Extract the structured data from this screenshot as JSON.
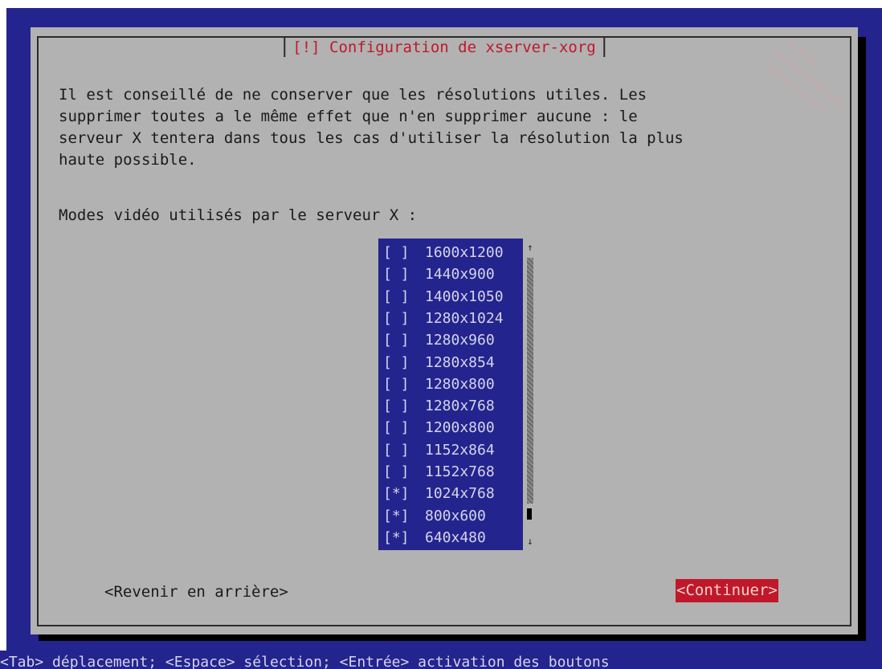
{
  "dialog": {
    "title": "[!] Configuration de xserver-xorg",
    "description": "Il est conseillé de ne conserver que les résolutions utiles. Les\nsupprimer toutes a le même effet que n'en supprimer aucune : le\nserveur X tentera dans tous les cas d'utiliser la résolution la plus\nhaute possible.",
    "modes_label": "Modes vidéo utilisés par le serveur X :"
  },
  "modes": [
    {
      "checked": false,
      "box": "[ ]",
      "label": "1600x1200"
    },
    {
      "checked": false,
      "box": "[ ]",
      "label": "1440x900"
    },
    {
      "checked": false,
      "box": "[ ]",
      "label": "1400x1050"
    },
    {
      "checked": false,
      "box": "[ ]",
      "label": "1280x1024"
    },
    {
      "checked": false,
      "box": "[ ]",
      "label": "1280x960"
    },
    {
      "checked": false,
      "box": "[ ]",
      "label": "1280x854"
    },
    {
      "checked": false,
      "box": "[ ]",
      "label": "1280x800"
    },
    {
      "checked": false,
      "box": "[ ]",
      "label": "1280x768"
    },
    {
      "checked": false,
      "box": "[ ]",
      "label": "1200x800"
    },
    {
      "checked": false,
      "box": "[ ]",
      "label": "1152x864"
    },
    {
      "checked": false,
      "box": "[ ]",
      "label": "1152x768"
    },
    {
      "checked": true,
      "box": "[*]",
      "label": "1024x768"
    },
    {
      "checked": true,
      "box": "[*]",
      "label": "800x600"
    },
    {
      "checked": true,
      "box": "[*]",
      "label": "640x480"
    }
  ],
  "scrollbar": {
    "up_arrow": "↑",
    "down_arrow": "↓"
  },
  "buttons": {
    "back": "<Revenir en arrière>",
    "continue": "<Continuer>"
  },
  "help_bar": "<Tab> déplacement; <Espace> sélection; <Entrée> activation des boutons",
  "colors": {
    "background": "#24248e",
    "dialog": "#b2b2b2",
    "accent": "#c0182a",
    "list_text": "#d4d4ec"
  }
}
